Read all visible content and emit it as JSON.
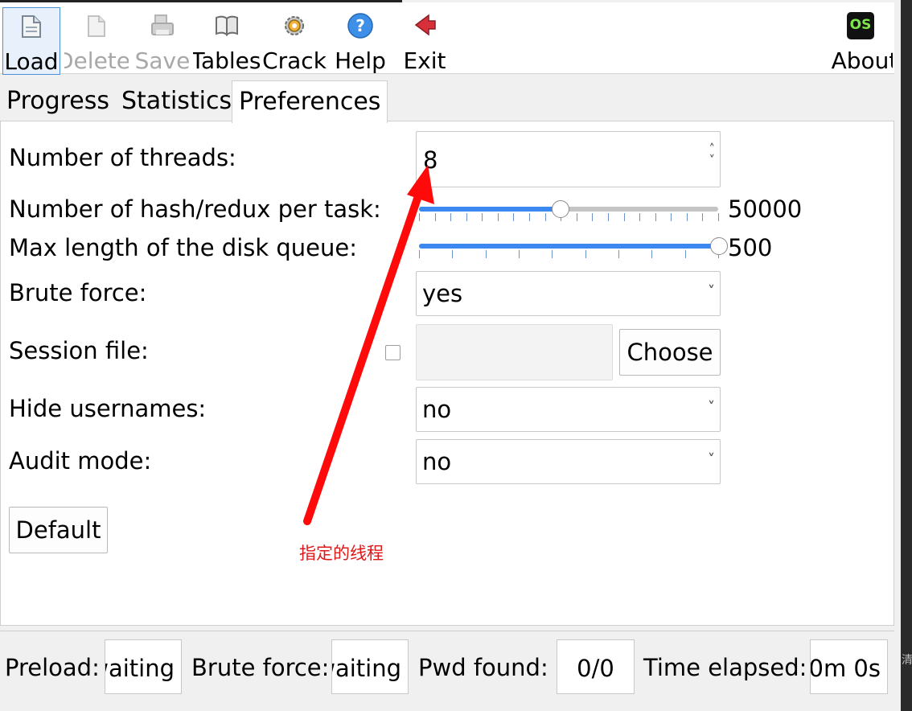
{
  "toolbar": {
    "load": "Load",
    "delete": "Delete",
    "save": "Save",
    "tables": "Tables",
    "crack": "Crack",
    "help": "Help",
    "exit": "Exit",
    "about": "About",
    "about_badge": "OS"
  },
  "tabs": {
    "progress": "Progress",
    "statistics": "Statistics",
    "preferences": "Preferences"
  },
  "preferences": {
    "threads_label": "Number of threads:",
    "threads_value": "8",
    "hash_label": "Number of hash/redux per task:",
    "hash_value": "50000",
    "hash_slider_fraction": 0.47,
    "queue_label": "Max length of the disk queue:",
    "queue_value": "500",
    "queue_slider_fraction": 1.0,
    "brute_label": "Brute force:",
    "brute_value": "yes",
    "session_label": "Session file:",
    "session_choose": "Choose",
    "hide_label": "Hide usernames:",
    "hide_value": "no",
    "audit_label": "Audit mode:",
    "audit_value": "no",
    "default_button": "Default"
  },
  "annotation": {
    "text": "指定的线程",
    "color": "#e01818"
  },
  "status": {
    "preload_label": "Preload:",
    "preload_value": "waiting",
    "brute_label": "Brute force:",
    "brute_value": "waiting",
    "pwd_label": "Pwd found:",
    "pwd_value": "0/0",
    "time_label": "Time elapsed:",
    "time_value": "0m 0s"
  },
  "side_glyph": "清",
  "colors": {
    "accent": "#3b88f0",
    "annotation_red": "#e01818"
  }
}
